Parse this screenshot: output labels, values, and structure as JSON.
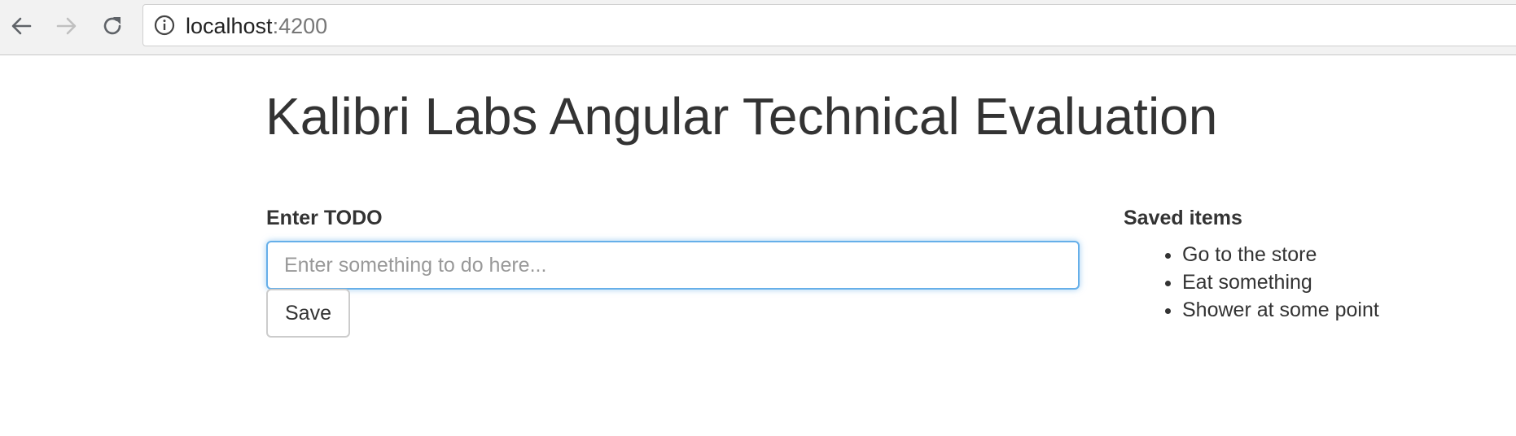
{
  "browser": {
    "url_host": "localhost",
    "url_port": ":4200",
    "icons": {
      "back": "arrow-left-icon",
      "forward": "arrow-right-icon",
      "reload": "reload-icon",
      "info": "info-icon"
    }
  },
  "page": {
    "title": "Kalibri Labs Angular Technical Evaluation"
  },
  "todo_form": {
    "label": "Enter TODO",
    "input_value": "",
    "input_placeholder": "Enter something to do here...",
    "save_label": "Save"
  },
  "saved": {
    "heading": "Saved items",
    "items": [
      "Go to the store",
      "Eat something",
      "Shower at some point"
    ]
  },
  "colors": {
    "text": "#333333",
    "input_focus_border": "#66afe9"
  }
}
